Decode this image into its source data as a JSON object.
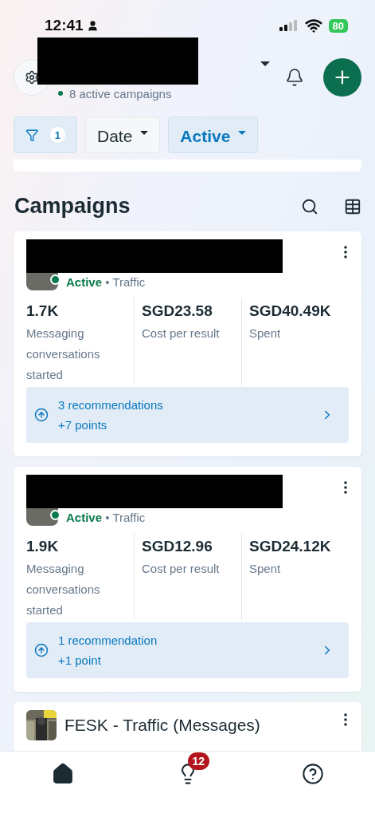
{
  "status_bar": {
    "time": "12:41",
    "battery": "80"
  },
  "header": {
    "subtitle": "8 active campaigns"
  },
  "filters": [
    {
      "kind": "filter",
      "count": "1",
      "selected": true
    },
    {
      "kind": "dropdown",
      "label": "Date",
      "selected": false
    },
    {
      "kind": "dropdown",
      "label": "Active",
      "selected": true
    }
  ],
  "section_title": "Campaigns",
  "campaigns": [
    {
      "status": "Active",
      "separator": "•",
      "objective": "Traffic",
      "metrics": [
        {
          "value": "1.7K",
          "label": "Messaging conversations started"
        },
        {
          "value": "SGD23.58",
          "label": "Cost per result"
        },
        {
          "value": "SGD40.49K",
          "label": "Spent"
        }
      ],
      "recommendation": {
        "title": "3 recommendations",
        "points": "+7 points"
      }
    },
    {
      "status": "Active",
      "separator": "•",
      "objective": "Traffic",
      "metrics": [
        {
          "value": "1.9K",
          "label": "Messaging conversations started"
        },
        {
          "value": "SGD12.96",
          "label": "Cost per result"
        },
        {
          "value": "SGD24.12K",
          "label": "Spent"
        }
      ],
      "recommendation": {
        "title": "1 recommendation",
        "points": "+1 point"
      }
    },
    {
      "title": "FESK - Traffic (Messages)"
    }
  ],
  "nav": [
    {
      "kind": "home",
      "selected": true
    },
    {
      "kind": "ideas",
      "badge": "12",
      "selected": false
    },
    {
      "kind": "help",
      "selected": false
    }
  ]
}
